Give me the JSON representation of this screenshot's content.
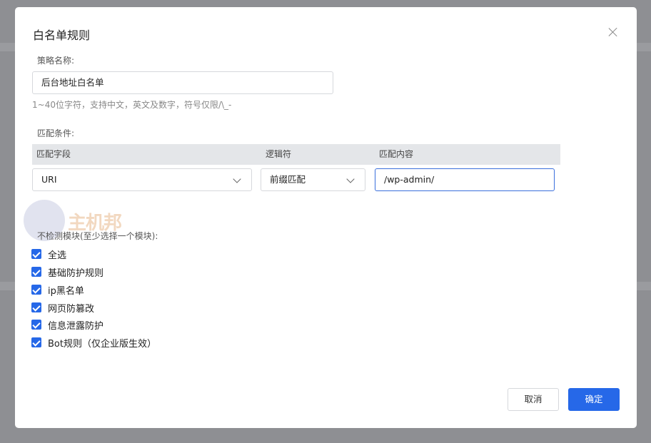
{
  "dialog": {
    "title": "白名单规则",
    "close_icon": "close-icon"
  },
  "policy_name": {
    "label": "策略名称:",
    "value": "后台地址白名单",
    "hint": "1~40位字符，支持中文，英文及数字，符号仅限/\\_-"
  },
  "match": {
    "label": "匹配条件:",
    "headers": [
      "匹配字段",
      "逻辑符",
      "匹配内容"
    ],
    "field_value": "URI",
    "operator_value": "前缀匹配",
    "content_value": "/wp-admin/"
  },
  "watermark": {
    "text": "主机邦"
  },
  "modules": {
    "label": "不检测模块(至少选择一个模块):",
    "items": [
      {
        "label": "全选",
        "checked": true
      },
      {
        "label": "基础防护规则",
        "checked": true
      },
      {
        "label": "ip黑名单",
        "checked": true
      },
      {
        "label": "网页防篡改",
        "checked": true
      },
      {
        "label": "信息泄露防护",
        "checked": true
      },
      {
        "label": "Bot规则（仅企业版生效）",
        "checked": true
      }
    ]
  },
  "footer": {
    "cancel_label": "取消",
    "ok_label": "确定"
  },
  "colors": {
    "primary": "#2668e8",
    "overlay": "#8e8f93"
  }
}
